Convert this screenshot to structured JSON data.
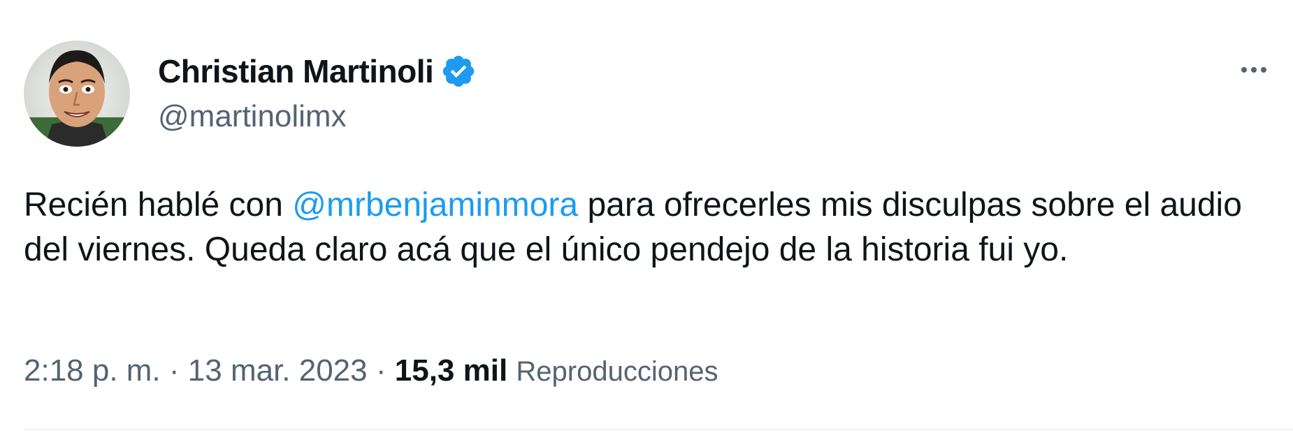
{
  "author": {
    "display_name": "Christian Martinoli",
    "handle": "@martinolimx",
    "verified": true
  },
  "tweet": {
    "text_before": "Recién hablé con ",
    "mention": "@mrbenjaminmora",
    "text_after": " para ofrecerles mis disculpas sobre el audio del viernes. Queda claro acá que el único pendejo de la historia fui yo."
  },
  "meta": {
    "time": "2:18 p. m.",
    "separator_1": " · ",
    "date": "13 mar. 2023",
    "separator_2": " · ",
    "views_count": "15,3 mil",
    "views_label": "Reproducciones"
  },
  "icons": {
    "avatar": "avatar-icon",
    "verified": "verified-badge-icon",
    "more": "more-options-icon"
  },
  "colors": {
    "text": "#0f1419",
    "secondary": "#536471",
    "accent": "#1d9bf0",
    "divider": "#eff3f4"
  }
}
